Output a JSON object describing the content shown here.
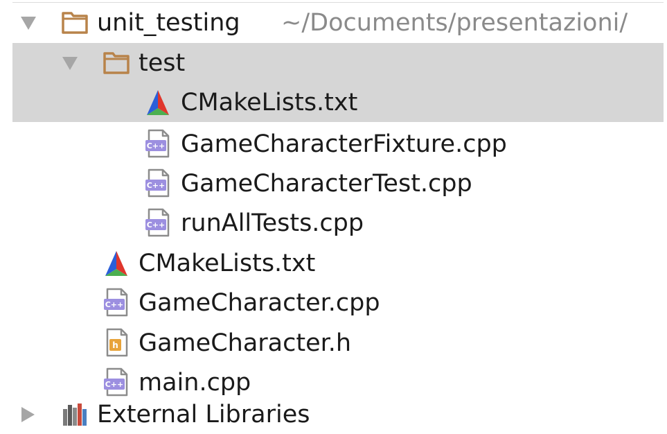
{
  "project_tree": {
    "root": {
      "label": "unit_testing",
      "path": "~/Documents/presentazioni/"
    },
    "items": [
      {
        "label": "test"
      },
      {
        "label": "CMakeLists.txt"
      },
      {
        "label": "GameCharacterFixture.cpp"
      },
      {
        "label": "GameCharacterTest.cpp"
      },
      {
        "label": "runAllTests.cpp"
      },
      {
        "label": "CMakeLists.txt"
      },
      {
        "label": "GameCharacter.cpp"
      },
      {
        "label": "GameCharacter.h"
      },
      {
        "label": "main.cpp"
      },
      {
        "label": "External Libraries"
      }
    ],
    "icon_texts": {
      "cpp": "C++",
      "header": "h"
    },
    "colors": {
      "selection": "#d6d6d6",
      "folder": "#b8834a",
      "cpp_badge": "#9c8fe0",
      "header_badge": "#e8a33a"
    }
  }
}
